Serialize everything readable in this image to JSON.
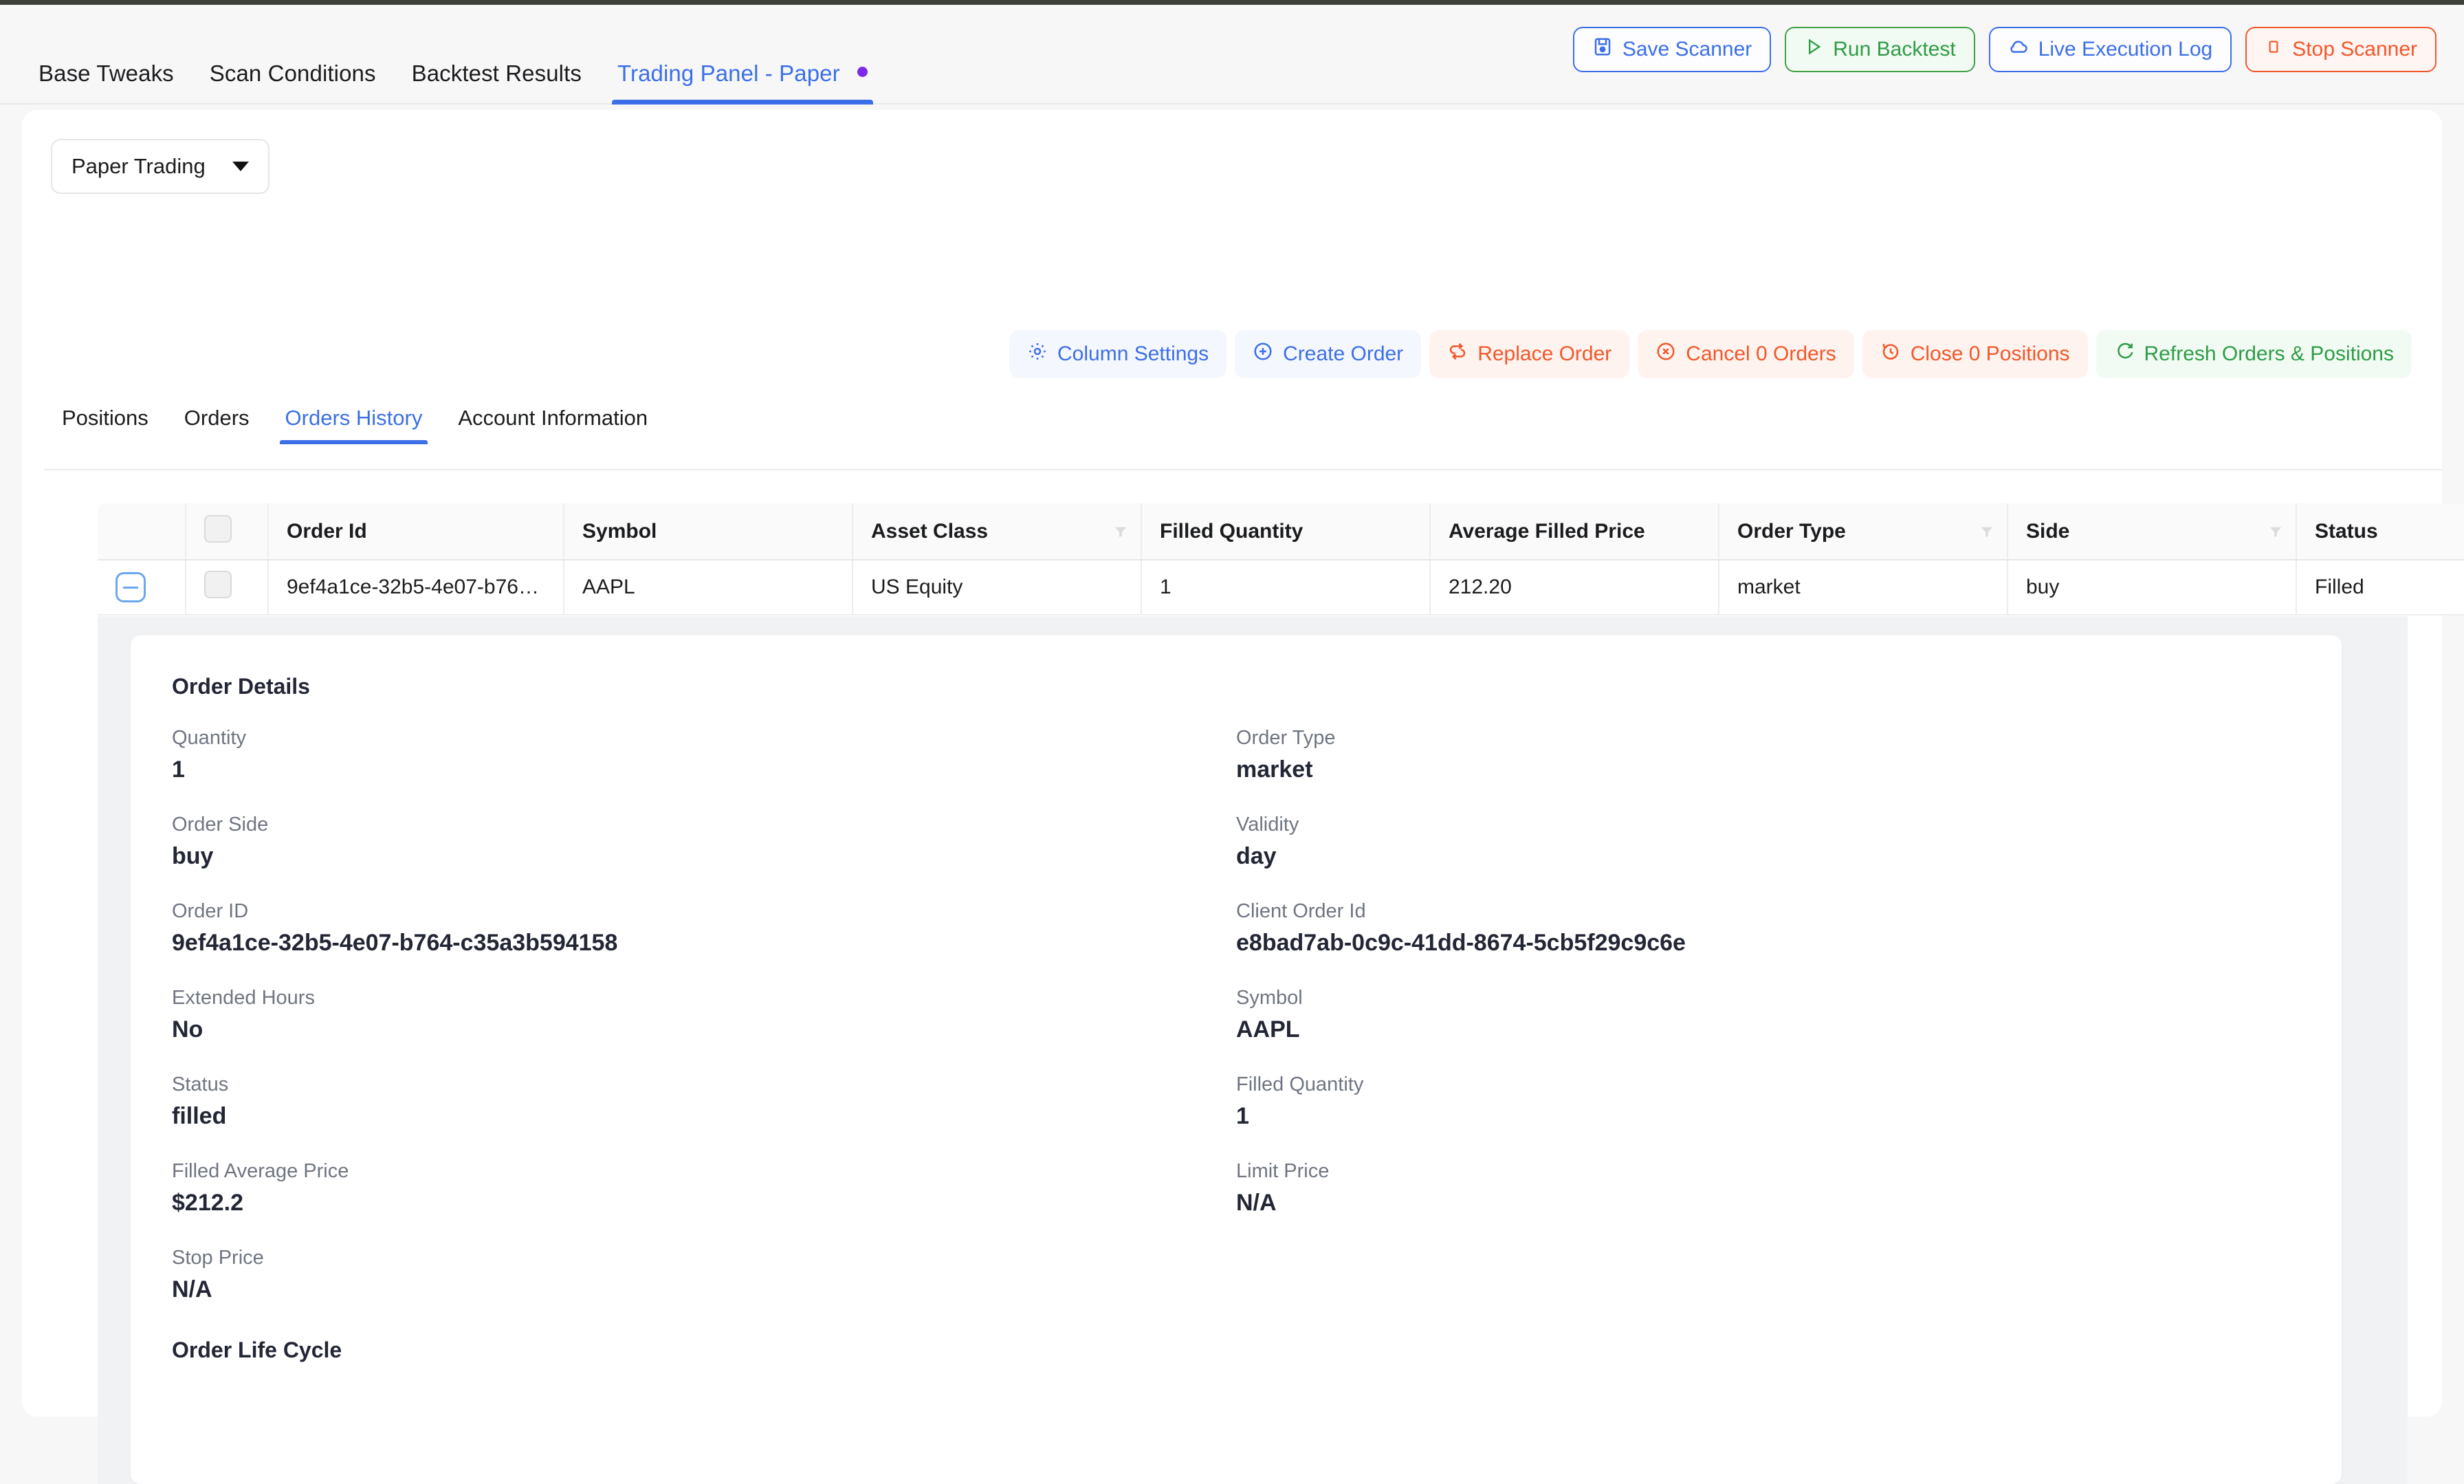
{
  "header": {
    "tabs": [
      {
        "label": "Base Tweaks",
        "active": false,
        "dot": false
      },
      {
        "label": "Scan Conditions",
        "active": false,
        "dot": false
      },
      {
        "label": "Backtest Results",
        "active": false,
        "dot": false
      },
      {
        "label": "Trading Panel - Paper",
        "active": true,
        "dot": true
      }
    ],
    "dot_color": "#7c2ae8",
    "actions": [
      {
        "label": "Save Scanner",
        "icon": "save-icon",
        "style": "white-blue"
      },
      {
        "label": "Run Backtest",
        "icon": "play-icon",
        "style": "green"
      },
      {
        "label": "Live Execution Log",
        "icon": "cloud-icon",
        "style": "white-blue"
      },
      {
        "label": "Stop Scanner",
        "icon": "stop-square-icon",
        "style": "orange"
      }
    ]
  },
  "account": {
    "selected": "Paper Trading"
  },
  "toolbar": [
    {
      "label": "Column Settings",
      "icon": "gear-icon",
      "style": "blue"
    },
    {
      "label": "Create Order",
      "icon": "plus-circle-icon",
      "style": "blue"
    },
    {
      "label": "Replace Order",
      "icon": "replace-icon",
      "style": "red"
    },
    {
      "label": "Cancel 0 Orders",
      "icon": "x-circle-icon",
      "style": "red"
    },
    {
      "label": "Close 0 Positions",
      "icon": "clock-back-icon",
      "style": "red"
    },
    {
      "label": "Refresh Orders & Positions",
      "icon": "refresh-icon",
      "style": "green"
    }
  ],
  "subtabs": [
    {
      "label": "Positions",
      "active": false
    },
    {
      "label": "Orders",
      "active": false
    },
    {
      "label": "Orders History",
      "active": true
    },
    {
      "label": "Account Information",
      "active": false
    }
  ],
  "table": {
    "columns": [
      {
        "label": "",
        "filter": false
      },
      {
        "label": "",
        "filter": false
      },
      {
        "label": "Order Id",
        "filter": false
      },
      {
        "label": "Symbol",
        "filter": false
      },
      {
        "label": "Asset Class",
        "filter": true
      },
      {
        "label": "Filled Quantity",
        "filter": false
      },
      {
        "label": "Average Filled Price",
        "filter": false
      },
      {
        "label": "Order Type",
        "filter": true
      },
      {
        "label": "Side",
        "filter": true
      },
      {
        "label": "Status",
        "filter": false
      }
    ],
    "rows": [
      {
        "order_id": "9ef4a1ce-32b5-4e07-b764…",
        "symbol": "AAPL",
        "asset_class": "US Equity",
        "filled_quantity": "1",
        "average_filled_price": "212.20",
        "order_type": "market",
        "side": "buy",
        "status": "Filled"
      }
    ]
  },
  "details": {
    "title": "Order Details",
    "fields": [
      {
        "label": "Quantity",
        "value": "1"
      },
      {
        "label": "Order Type",
        "value": "market"
      },
      {
        "label": "Order Side",
        "value": "buy"
      },
      {
        "label": "Validity",
        "value": "day"
      },
      {
        "label": "Order ID",
        "value": "9ef4a1ce-32b5-4e07-b764-c35a3b594158"
      },
      {
        "label": "Client Order Id",
        "value": "e8bad7ab-0c9c-41dd-8674-5cb5f29c9c6e"
      },
      {
        "label": "Extended Hours",
        "value": "No"
      },
      {
        "label": "Symbol",
        "value": "AAPL"
      },
      {
        "label": "Status",
        "value": "filled"
      },
      {
        "label": "Filled Quantity",
        "value": "1"
      },
      {
        "label": "Filled Average Price",
        "value": "$212.2"
      },
      {
        "label": "Limit Price",
        "value": "N/A"
      },
      {
        "label": "Stop Price",
        "value": "N/A"
      },
      {
        "label": "",
        "value": ""
      }
    ],
    "lifecycle_title": "Order Life Cycle"
  },
  "colors": {
    "accent_blue": "#3b6fe8",
    "accent_green": "#2e9c45",
    "accent_red": "#f2572a",
    "accent_purple": "#7c2ae8",
    "page_bg": "#f7f7f8"
  }
}
